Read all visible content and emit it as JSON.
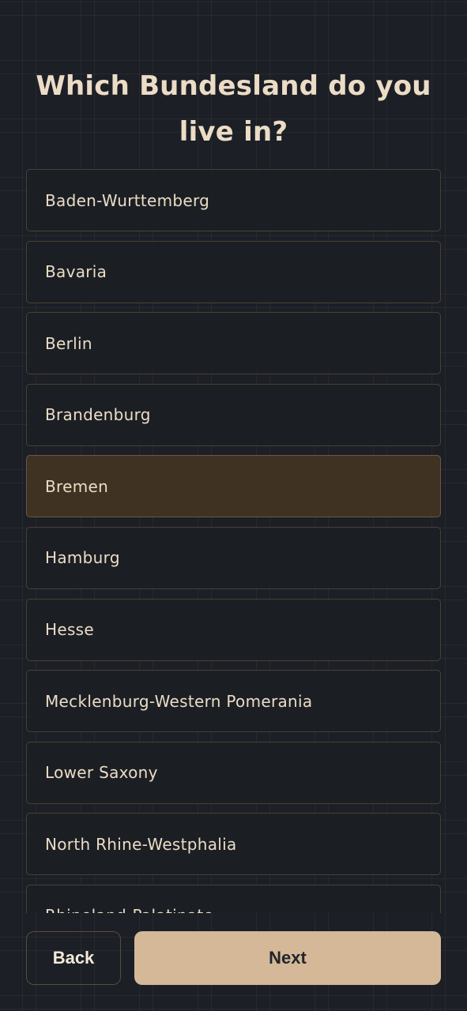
{
  "header": {
    "title": "Which Bundesland do you live in?"
  },
  "options": {
    "selected": "Bremen",
    "items": [
      {
        "label": "Baden-Wurttemberg"
      },
      {
        "label": "Bavaria"
      },
      {
        "label": "Berlin"
      },
      {
        "label": "Brandenburg"
      },
      {
        "label": "Bremen"
      },
      {
        "label": "Hamburg"
      },
      {
        "label": "Hesse"
      },
      {
        "label": "Mecklenburg-Western Pomerania"
      },
      {
        "label": "Lower Saxony"
      },
      {
        "label": "North Rhine-Westphalia"
      },
      {
        "label": "Rhineland-Palatinate"
      }
    ]
  },
  "footer": {
    "back_label": "Back",
    "next_label": "Next"
  },
  "colors": {
    "background": "#1c1f25",
    "accent": "#d4b898",
    "selected_option": "#3f3222",
    "text": "#ecdcc6"
  }
}
